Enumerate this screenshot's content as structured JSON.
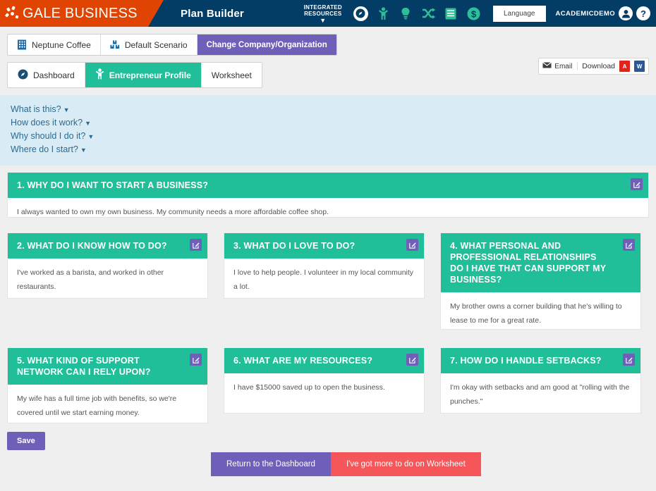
{
  "header": {
    "brand": "GALE BUSINESS",
    "app_title": "Plan Builder",
    "integrated_resources_line1": "INTEGRATED",
    "integrated_resources_line2": "RESOURCES",
    "icons": [
      "compass-icon",
      "person-raised-arms-icon",
      "lightbulb-icon",
      "shuffle-icon",
      "book-icon",
      "dollar-icon"
    ],
    "language_label": "Language",
    "account_name": "ACADEMICDEMO",
    "account_icon": "user-icon",
    "help_icon": "question-mark-icon",
    "colors": {
      "navy": "#033d66",
      "orange": "#e04403"
    }
  },
  "scenario_bar": {
    "company": "Neptune Coffee",
    "company_icon": "building-icon",
    "scenario": "Default Scenario",
    "scenario_icon": "boxes-icon",
    "change_button": "Change Company/Organization"
  },
  "export": {
    "email_label": "Email",
    "email_icon": "envelope-icon",
    "download_label": "Download",
    "pdf_icon": "pdf-file-icon",
    "word_icon": "word-file-icon"
  },
  "tabs": [
    {
      "label": "Dashboard",
      "icon": "compass-icon",
      "active": false
    },
    {
      "label": "Entrepreneur Profile",
      "icon": "person-raised-arms-icon",
      "active": true
    },
    {
      "label": "Worksheet",
      "icon": "",
      "active": false
    }
  ],
  "help_links": [
    "What is this?",
    "How does it work?",
    "Why should I do it?",
    "Where do I start?"
  ],
  "questions": [
    {
      "title": "1. WHY DO I WANT TO START A BUSINESS?",
      "answer": "I always wanted to own my own business. My community needs a more affordable coffee shop."
    },
    {
      "title": "2. WHAT DO I KNOW HOW TO DO?",
      "answer": "I've worked as a barista, and worked in other restaurants."
    },
    {
      "title": "3. WHAT DO I LOVE TO DO?",
      "answer": "I love to help people.  I volunteer in my local community a lot."
    },
    {
      "title": "4. WHAT PERSONAL AND PROFESSIONAL RELATIONSHIPS DO I HAVE THAT CAN SUPPORT MY BUSINESS?",
      "answer": "My brother owns a corner building that he's willing to lease to me for a great rate."
    },
    {
      "title": "5. WHAT KIND OF SUPPORT NETWORK CAN I RELY UPON?",
      "answer": "My wife has a full time job with benefits, so we're covered until we start earning money."
    },
    {
      "title": "6. WHAT ARE MY RESOURCES?",
      "answer": "I have $15000 saved up to open the business."
    },
    {
      "title": "7. HOW DO I HANDLE SETBACKS?",
      "answer": "I'm okay with setbacks and am good at \"rolling with the punches.\""
    }
  ],
  "edit_icon_name": "edit-pencil-square-icon",
  "footer": {
    "save": "Save",
    "return_dashboard": "Return to the Dashboard",
    "more_worksheet": "I've got more to do on Worksheet"
  }
}
